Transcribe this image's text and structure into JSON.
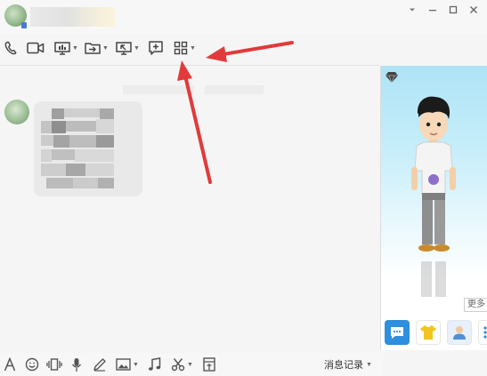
{
  "chat_header": {
    "contact_name": "",
    "window_controls": [
      "chevron-down-icon",
      "minimize-icon",
      "maximize-icon",
      "close-icon"
    ]
  },
  "toolbar": {
    "items": [
      {
        "name": "voice-call",
        "icon": "phone-icon",
        "has_dropdown": false
      },
      {
        "name": "video-call",
        "icon": "video-camera-icon",
        "has_dropdown": false
      },
      {
        "name": "screen-share",
        "icon": "presentation-icon",
        "has_dropdown": true
      },
      {
        "name": "file-transfer",
        "icon": "folder-transfer-icon",
        "has_dropdown": true
      },
      {
        "name": "remote-desktop",
        "icon": "remote-desktop-icon",
        "has_dropdown": true
      },
      {
        "name": "group-chat",
        "icon": "add-chat-icon",
        "has_dropdown": false
      },
      {
        "name": "apps",
        "icon": "grid-apps-icon",
        "has_dropdown": true
      }
    ]
  },
  "sidebar": {
    "more_label": "更多",
    "actions": [
      "chat-bubble-icon",
      "shirt-icon",
      "person-icon",
      "vertical-dots-icon"
    ],
    "colors": {
      "sky_top": "#aee3f6",
      "chat_button": "#2d8fdd"
    }
  },
  "input_toolbar": {
    "items": [
      "font-icon",
      "emoji-icon",
      "shake-icon",
      "microphone-icon",
      "pen-icon",
      "image-icon",
      "music-note-icon",
      "scissors-icon",
      "gift-icon"
    ],
    "history_label": "消息记录"
  },
  "annotation": {
    "arrow_color": "#e23a3a"
  }
}
